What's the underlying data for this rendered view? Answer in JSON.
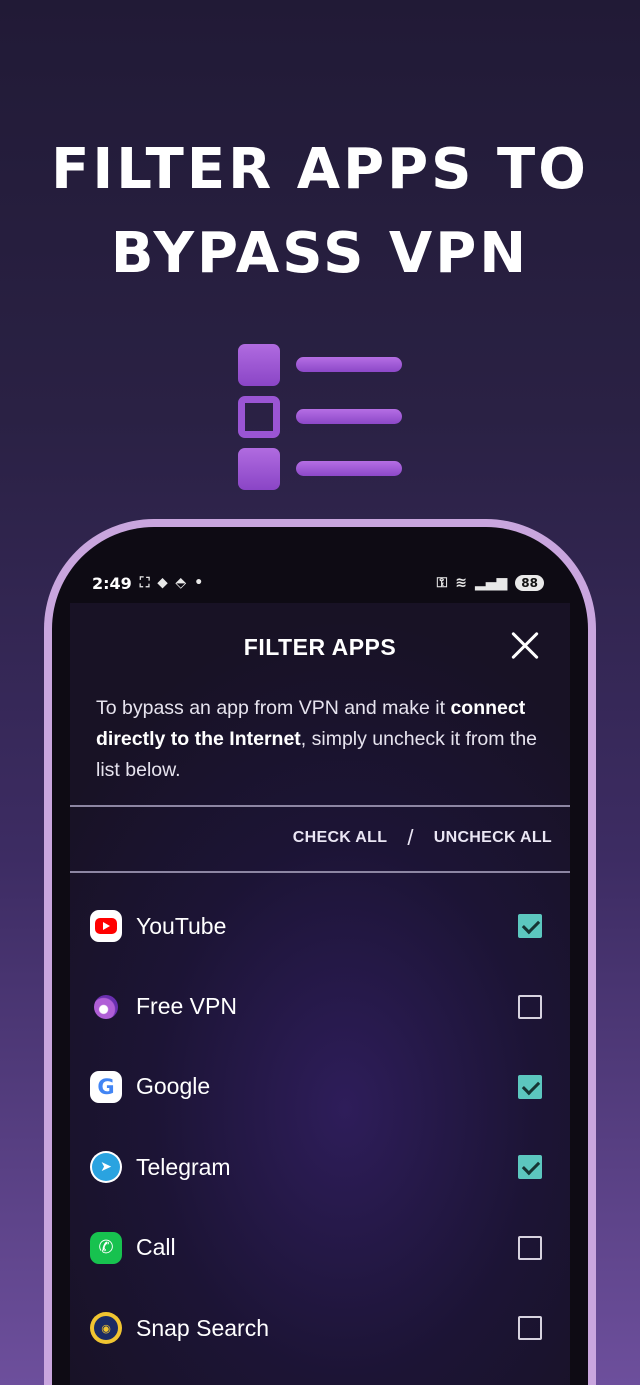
{
  "headline": {
    "line1": "FILTER APPS TO",
    "line2": "BYPASS VPN"
  },
  "status_bar": {
    "time": "2:49",
    "battery": "88"
  },
  "dialog": {
    "title": "FILTER APPS",
    "description_part1": "To bypass an app from VPN and make it ",
    "description_bold": "connect directly to the Internet",
    "description_part2": ", simply uncheck it from the list below.",
    "check_all": "CHECK ALL",
    "separator": "/",
    "uncheck_all": "UNCHECK ALL"
  },
  "apps": [
    {
      "name": "YouTube",
      "icon": "youtube-icon",
      "checked": true
    },
    {
      "name": "Free VPN",
      "icon": "free-vpn-icon",
      "checked": false
    },
    {
      "name": "Google",
      "icon": "google-icon",
      "checked": true
    },
    {
      "name": "Telegram",
      "icon": "telegram-icon",
      "checked": true
    },
    {
      "name": "Call",
      "icon": "phone-icon",
      "checked": false
    },
    {
      "name": "Snap Search",
      "icon": "snap-search-icon",
      "checked": false
    }
  ],
  "colors": {
    "checkbox_checked": "#5cc7bf",
    "accent_purple": "#9a55d4",
    "phone_frame": "#c9a6de"
  }
}
